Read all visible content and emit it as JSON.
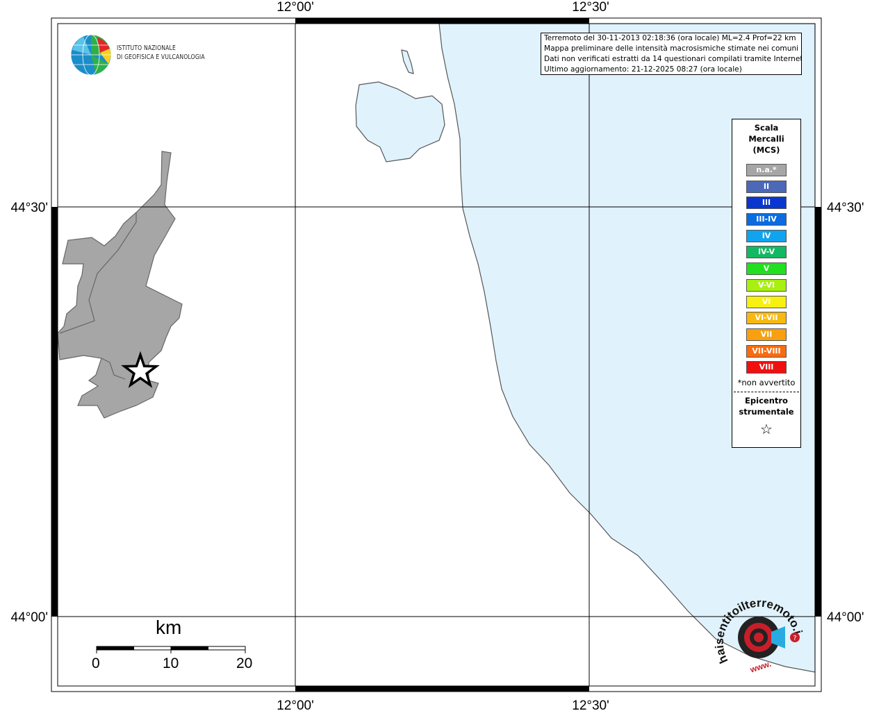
{
  "map": {
    "lon_labels": [
      "12°00'",
      "12°30'"
    ],
    "lat_labels": [
      "44°30'",
      "44°00'"
    ],
    "colors": {
      "sea": "#e0f2fc",
      "municipality": "#a6a6a6",
      "frame": "#000000"
    }
  },
  "logo": {
    "line1": "ISTITUTO NAZIONALE",
    "line2": "DI GEOFISICA E VULCANOLOGIA"
  },
  "info": {
    "line1": "Terremoto del 30-11-2013 02:18:36 (ora locale) ML=2.4 Prof=22 km",
    "line2": "Mappa preliminare delle intensità macrosismiche stimate nei comuni",
    "line3": "Dati non verificati estratti da 14 questionari compilati tramite Internet.",
    "line4": "Ultimo aggiornamento: 21-12-2025 08:27 (ora locale)"
  },
  "legend": {
    "title1": "Scala",
    "title2": "Mercalli",
    "title3": "(MCS)",
    "items": [
      {
        "label": "n.a.*",
        "color": "#a6a6a6"
      },
      {
        "label": "II",
        "color": "#4c68b8"
      },
      {
        "label": "III",
        "color": "#0a36d0"
      },
      {
        "label": "III-IV",
        "color": "#0a6ce0"
      },
      {
        "label": "IV",
        "color": "#10a4ee"
      },
      {
        "label": "IV-V",
        "color": "#12b862"
      },
      {
        "label": "V",
        "color": "#20e020"
      },
      {
        "label": "V-VI",
        "color": "#a8f010"
      },
      {
        "label": "VI",
        "color": "#f8f010"
      },
      {
        "label": "VI-VII",
        "color": "#f8b810"
      },
      {
        "label": "VII",
        "color": "#f8a010"
      },
      {
        "label": "VII-VIII",
        "color": "#f86c10"
      },
      {
        "label": "VIII",
        "color": "#f01010"
      }
    ],
    "note": "*non avvertito",
    "epi1": "Epicentro",
    "epi2": "strumentale",
    "epi_icon": "star-icon"
  },
  "scalebar": {
    "unit": "km",
    "labels": [
      "0",
      "10",
      "20"
    ]
  },
  "brand": {
    "text": "haisentitoilterremoto.it",
    "prefix": "www."
  }
}
